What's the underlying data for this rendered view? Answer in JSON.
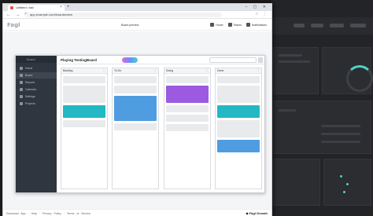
{
  "browser": {
    "tab_title": "Untitled • tab",
    "new_tab_label": "+",
    "window_controls": "– ▢ ✕",
    "nav_buttons": "← → ⟳",
    "url": "app.example.com/boards/view",
    "extensions": "☆ ⋮"
  },
  "app": {
    "logo": "Fagl",
    "center_label": "Board preview",
    "nav": [
      {
        "label": "Home",
        "icon": "home-icon"
      },
      {
        "label": "Teams",
        "icon": "team-icon"
      },
      {
        "label": "Notifications",
        "icon": "bell-icon"
      }
    ]
  },
  "board": {
    "title": "Playing TestingBoard",
    "sidebar_brand": "Board",
    "sidebar_items": [
      {
        "label": "Home",
        "active": false
      },
      {
        "label": "Board",
        "active": true
      },
      {
        "label": "Reports",
        "active": false
      },
      {
        "label": "Calendar",
        "active": false
      },
      {
        "label": "Settings",
        "active": false
      },
      {
        "label": "Projects",
        "active": false
      }
    ],
    "columns": [
      {
        "name": "Backlog",
        "cards": [
          {
            "h": 9,
            "color": "#e9eaec"
          },
          {
            "h": 22,
            "color": "#e9eaec"
          },
          {
            "h": 16,
            "color": "#24b8c2"
          },
          {
            "h": 9,
            "color": "#e9eaec"
          }
        ]
      },
      {
        "name": "To Do",
        "cards": [
          {
            "h": 9,
            "color": "#e9eaec"
          },
          {
            "h": 10,
            "color": "#e9eaec"
          },
          {
            "h": 32,
            "color": "#4f9de0"
          },
          {
            "h": 9,
            "color": "#e9eaec"
          }
        ]
      },
      {
        "name": "Doing",
        "cards": [
          {
            "h": 9,
            "color": "#e9eaec"
          },
          {
            "h": 22,
            "color": "#9c5ae0"
          },
          {
            "h": 9,
            "color": "#e9eaec"
          },
          {
            "h": 9,
            "color": "#e9eaec"
          },
          {
            "h": 9,
            "color": "#e9eaec"
          }
        ]
      },
      {
        "name": "Done",
        "cards": [
          {
            "h": 9,
            "color": "#e9eaec"
          },
          {
            "h": 22,
            "color": "#e9eaec"
          },
          {
            "h": 16,
            "color": "#24b8c2"
          },
          {
            "h": 22,
            "color": "#e9eaec"
          },
          {
            "h": 16,
            "color": "#4f9de0"
          }
        ]
      }
    ]
  },
  "footer": {
    "links": "Download App · Help · Privacy Policy · Terms of Service",
    "brand": "◆ Fagl Growth"
  },
  "colors": {
    "teal": "#24b8c2",
    "blue": "#4f9de0",
    "purple": "#9c5ae0",
    "sidebar": "#2f3640"
  }
}
